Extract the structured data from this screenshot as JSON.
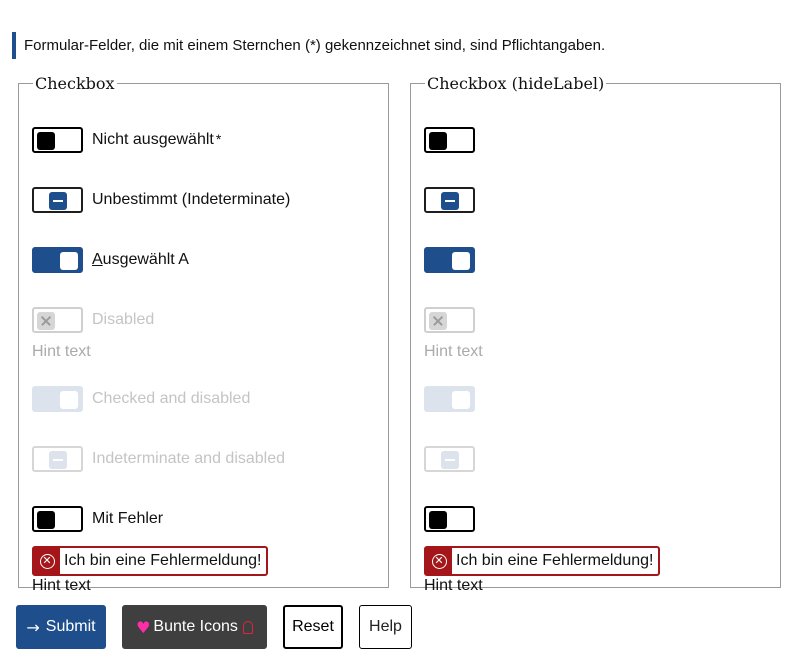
{
  "required_note": "Formular-Felder, die mit einem Sternchen (*) gekennzeichnet sind, sind Pflichtangaben.",
  "fieldsets": {
    "left": {
      "legend": "Checkbox",
      "items": [
        {
          "label_pre": "",
          "label_accent": "",
          "label_post": "Nicht ausgewählt",
          "required": "*"
        },
        {
          "label_pre": "",
          "label_accent": "",
          "label_post": "Unbestimmt (Indeterminate)"
        },
        {
          "label_pre": "",
          "label_accent": "A",
          "label_post": "usgewählt A"
        },
        {
          "label_pre": "",
          "label_accent": "",
          "label_post": "Disabled"
        },
        {
          "label_pre": "",
          "label_accent": "",
          "label_post": "Checked and disabled"
        },
        {
          "label_pre": "",
          "label_accent": "",
          "label_post": "Indeterminate and disabled"
        },
        {
          "label_pre": "",
          "label_accent": "",
          "label_post": "Mit Fehler"
        }
      ],
      "hint_disabled": "Hint text",
      "error_message": "Ich bin eine Fehlermeldung!",
      "hint_error": "Hint text"
    },
    "right": {
      "legend": "Checkbox (hideLabel)",
      "hint_disabled": "Hint text",
      "error_message": "Ich bin eine Fehlermeldung!",
      "hint_error": "Hint text"
    }
  },
  "buttons": {
    "submit": "Submit",
    "bunte_icons": "Bunte Icons",
    "reset": "Reset",
    "help": "Help"
  },
  "icons": {
    "submit": "arrow-right-icon",
    "bunte_left": "heart-icon",
    "bunte_right": "ghost-icon",
    "error": "error-circle-icon"
  },
  "colors": {
    "primary": "#1e4f8c",
    "error": "#a4161a",
    "dark_button": "#3f3f3f",
    "heart": "#ff2ea8"
  },
  "states": {
    "toggle_1": "unchecked",
    "toggle_2": "indeterminate",
    "toggle_3": "checked",
    "toggle_4": "disabled",
    "toggle_5": "checked-disabled",
    "toggle_6": "indeterminate-disabled",
    "toggle_7": "unchecked-error"
  }
}
